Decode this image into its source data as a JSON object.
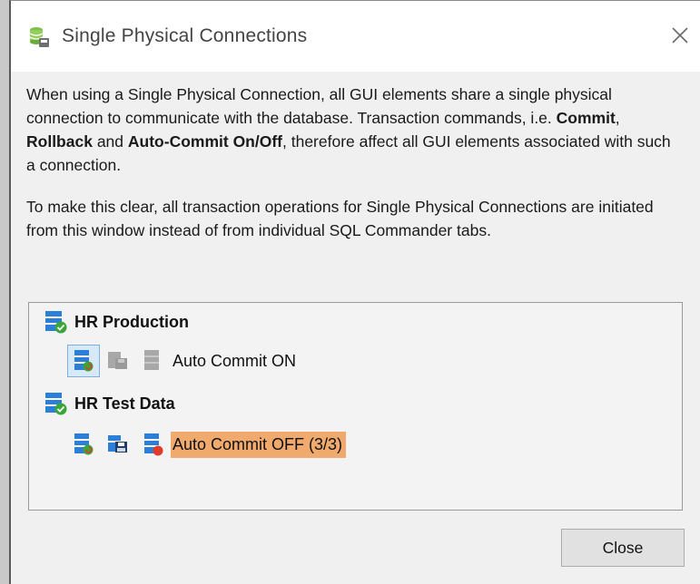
{
  "window": {
    "title": "Single Physical Connections",
    "title_icon": "database-connections-icon",
    "close_icon": "close-icon"
  },
  "description": {
    "p1_a": "When using a Single Physical Connection, all GUI elements share a single physical connection to communicate with the database. Transaction commands, i.e. ",
    "p1_commit": "Commit",
    "p1_sep1": ", ",
    "p1_rollback": "Rollback",
    "p1_sep2": " and ",
    "p1_autocommit": "Auto-Commit On/Off",
    "p1_b": ", therefore affect all GUI elements associated with such a connection.",
    "p2": "To make this clear, all transaction operations for Single Physical Connections are initiated from this window instead of from individual SQL Commander tabs."
  },
  "connections": [
    {
      "name": "HR Production",
      "icon": "database-connected-icon",
      "controls": [
        {
          "name": "toggle-auto-commit-icon",
          "enabled": true,
          "selected": true
        },
        {
          "name": "commit-icon",
          "enabled": false
        },
        {
          "name": "rollback-icon",
          "enabled": false
        }
      ],
      "status": "Auto Commit ON",
      "highlight": false
    },
    {
      "name": "HR Test Data",
      "icon": "database-connected-icon",
      "controls": [
        {
          "name": "toggle-auto-commit-icon",
          "enabled": true,
          "selected": false
        },
        {
          "name": "commit-icon",
          "enabled": true
        },
        {
          "name": "rollback-icon",
          "enabled": true
        }
      ],
      "status": "Auto Commit OFF (3/3)",
      "highlight": true
    }
  ],
  "colors": {
    "db_blue": "#2b7fd6",
    "check_green": "#3aa63a",
    "status_off_bg": "#f0aa6e",
    "disabled_gray": "#a8a8a8",
    "rollback_red": "#e03b2b"
  },
  "buttons": {
    "close": "Close"
  }
}
